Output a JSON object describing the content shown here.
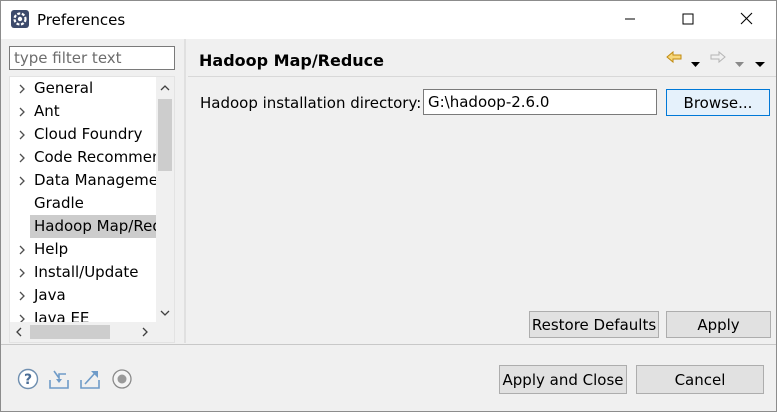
{
  "window": {
    "title": "Preferences",
    "icons": {
      "app": "preferences-gear-icon",
      "minimize": "minimize-icon",
      "maximize": "maximize-icon",
      "close": "close-icon"
    }
  },
  "filter": {
    "placeholder": "type filter text",
    "value": ""
  },
  "tree": {
    "items": [
      {
        "label": "General",
        "expandable": true,
        "selected": false
      },
      {
        "label": "Ant",
        "expandable": true,
        "selected": false
      },
      {
        "label": "Cloud Foundry",
        "expandable": true,
        "selected": false
      },
      {
        "label": "Code Recommenders",
        "expandable": true,
        "selected": false
      },
      {
        "label": "Data Management",
        "expandable": true,
        "selected": false
      },
      {
        "label": "Gradle",
        "expandable": false,
        "selected": false
      },
      {
        "label": "Hadoop Map/Reduce",
        "expandable": false,
        "selected": true
      },
      {
        "label": "Help",
        "expandable": true,
        "selected": false
      },
      {
        "label": "Install/Update",
        "expandable": true,
        "selected": false
      },
      {
        "label": "Java",
        "expandable": true,
        "selected": false
      },
      {
        "label": "Java EE",
        "expandable": true,
        "selected": false
      }
    ]
  },
  "page": {
    "title": "Hadoop Map/Reduce",
    "nav": {
      "back": "back-arrow-icon",
      "forward": "forward-arrow-icon",
      "menu": "view-menu-icon"
    },
    "dir_label": "Hadoop installation directory:",
    "dir_value": "G:\\hadoop-2.6.0",
    "browse_label": "Browse...",
    "restore_label": "Restore Defaults",
    "apply_label": "Apply"
  },
  "footer": {
    "icons": [
      "help-icon",
      "import-icon",
      "export-icon",
      "record-icon"
    ],
    "apply_close_label": "Apply and Close",
    "cancel_label": "Cancel"
  },
  "colors": {
    "selection": "#cccccc",
    "accent": "#0078d7",
    "nav_arrow": "#e0a020"
  }
}
